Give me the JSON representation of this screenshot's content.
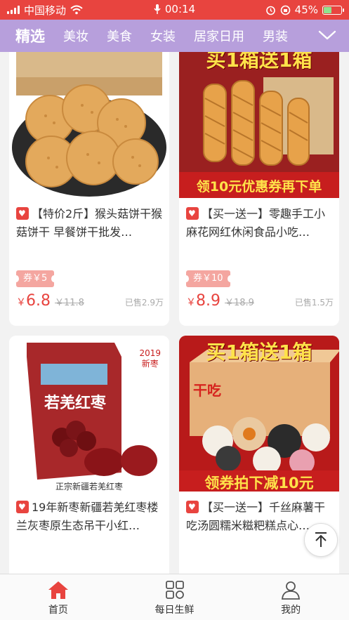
{
  "status_bar": {
    "carrier": "中国移动",
    "time": "00:14",
    "battery_percent": "45%",
    "battery_level": 0.45
  },
  "categories": {
    "tabs": [
      "精选",
      "美妆",
      "美食",
      "女装",
      "居家日用",
      "男装"
    ],
    "active_index": 0
  },
  "products": [
    {
      "title": "【特价2斤】猴头菇饼干猴菇饼干 早餐饼干批发…",
      "coupon": "券￥5",
      "currency": "￥",
      "price": "6.8",
      "original_price": "￥11.8",
      "sold": "已售2.9万",
      "image_text": ""
    },
    {
      "title": "【买一送一】零趣手工小麻花网红休闲食品小吃…",
      "coupon": "券￥10",
      "currency": "￥",
      "price": "8.9",
      "original_price": "￥18.9",
      "sold": "已售1.5万",
      "image_text": {
        "top": "买1箱送1箱",
        "bottom": "领10元优惠券再下单"
      }
    },
    {
      "title": "19年新枣新疆若羌红枣楼兰灰枣原生态吊干小红…",
      "coupon": "",
      "image_text": {
        "brand": "若羌红枣",
        "year": "2019\n新枣",
        "caption": "正宗新疆若羌红枣"
      }
    },
    {
      "title": "【买一送一】千丝麻薯干吃汤圆糯米糍粑糕点心…",
      "coupon": "",
      "image_text": {
        "top": "买1箱送1箱",
        "box": "干吃",
        "bottom": "领券拍下减10元"
      }
    }
  ],
  "bottom_nav": {
    "items": [
      "首页",
      "每日生鲜",
      "我的"
    ],
    "active_index": 0
  },
  "colors": {
    "accent_red": "#e8443f",
    "tab_bar_purple": "#b79fdc"
  }
}
